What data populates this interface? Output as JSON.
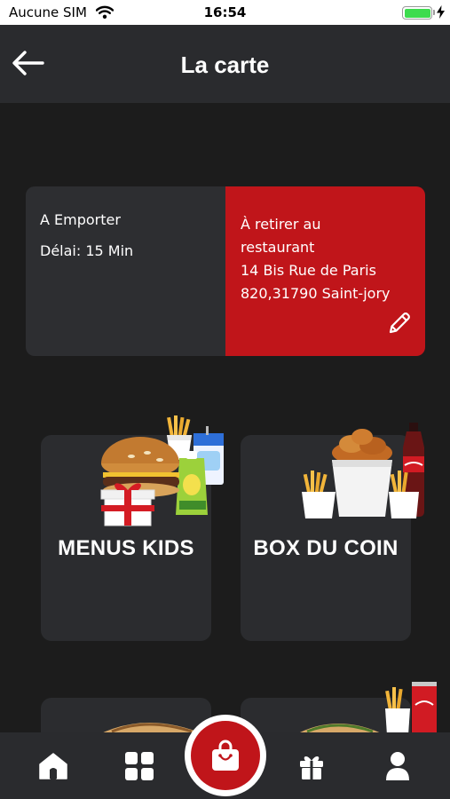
{
  "status_bar": {
    "carrier": "Aucune SIM",
    "time": "16:54",
    "battery_level": 1.0
  },
  "nav": {
    "title": "La carte"
  },
  "order_info": {
    "mode": "A Emporter",
    "delay": "Délai: 15 Min",
    "pickup_line1": "À retirer au",
    "pickup_line2": "restaurant",
    "address_line1": "14 Bis Rue de Paris",
    "address_line2": "820,31790 Saint-jory"
  },
  "categories": [
    {
      "label": "MENUS KIDS",
      "icon": "kids-menu-image"
    },
    {
      "label": "BOX DU COIN",
      "icon": "chicken-box-image"
    },
    {
      "label": "",
      "icon": "sandwich-image"
    },
    {
      "label": "",
      "icon": "sandwich-cola-image"
    }
  ],
  "tab_bar": {
    "items": [
      "home-icon",
      "grid-icon",
      "bag-icon",
      "gift-icon",
      "profile-icon"
    ]
  },
  "colors": {
    "accent_red": "#c0151a",
    "background": "#1c1c1c",
    "card": "#2b2c2f"
  }
}
